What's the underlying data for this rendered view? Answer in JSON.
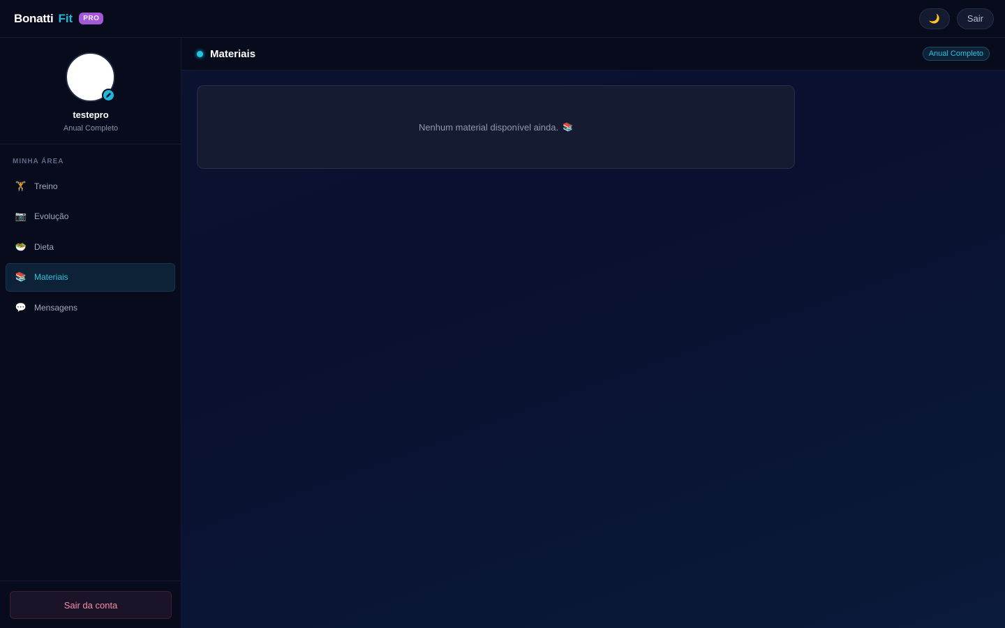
{
  "header": {
    "brand_name": "Bonatti",
    "brand_accent": "Fit",
    "pro_badge": "PRO",
    "theme_icon": "moon-icon",
    "logout_short": "Sair"
  },
  "profile": {
    "username": "testepro",
    "plan": "Anual Completo",
    "edit_icon": "pencil-icon"
  },
  "sidebar": {
    "section_label": "MINHA ÁREA",
    "items": [
      {
        "label": "Treino",
        "icon": "dumbbell-icon",
        "glyph": "🏋",
        "active": false
      },
      {
        "label": "Evolução",
        "icon": "camera-icon",
        "glyph": "📷",
        "active": false
      },
      {
        "label": "Dieta",
        "icon": "salad-icon",
        "glyph": "🥗",
        "active": false
      },
      {
        "label": "Materiais",
        "icon": "books-icon",
        "glyph": "📚",
        "active": true
      },
      {
        "label": "Mensagens",
        "icon": "speech-bubble-icon",
        "glyph": "💬",
        "active": false
      }
    ],
    "logout_label": "Sair da conta"
  },
  "main": {
    "title": "Materiais",
    "plan_badge": "Anual Completo",
    "empty_message": "Nenhum material disponível ainda.",
    "empty_icon": "books-icon"
  },
  "colors": {
    "accent": "#22b8d6",
    "pro": "#a259d9",
    "background": "#0a0f24",
    "danger": "#f58fa5"
  }
}
